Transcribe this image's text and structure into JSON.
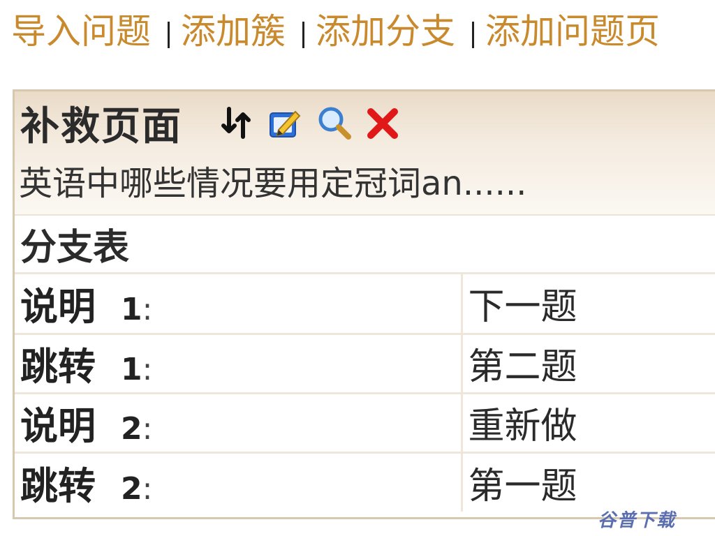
{
  "toolbar": {
    "links": [
      "导入问题",
      "添加簇",
      "添加分支",
      "添加问题页"
    ]
  },
  "panel": {
    "title": "补救页面",
    "icons": [
      "sort-arrows-icon",
      "edit-icon",
      "search-icon",
      "delete-icon"
    ],
    "description": "英语中哪些情况要用定冠词an......",
    "branch_table_title": "分支表",
    "rows": [
      {
        "label": "说明",
        "number": "1",
        "colon": ":",
        "value": "下一题"
      },
      {
        "label": "跳转",
        "number": "1",
        "colon": ":",
        "value": "第二题"
      },
      {
        "label": "说明",
        "number": "2",
        "colon": ":",
        "value": "重新做"
      },
      {
        "label": "跳转",
        "number": "2",
        "colon": ":",
        "value": "第一题"
      }
    ]
  },
  "watermark": "谷普下载",
  "colors": {
    "link": "#c98a2e",
    "header_gradient_top": "#eadbc8",
    "border": "#d7c8b0",
    "delete": "#e01818"
  }
}
